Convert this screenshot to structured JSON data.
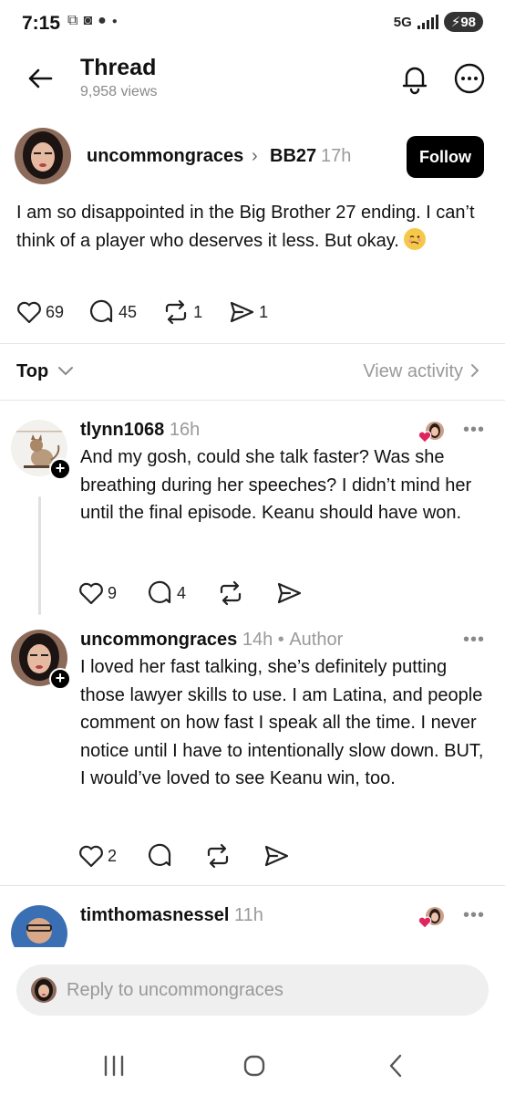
{
  "status_bar": {
    "time": "7:15",
    "network": "5G",
    "battery": "98"
  },
  "header": {
    "title": "Thread",
    "views": "9,958 views"
  },
  "post": {
    "author": "uncommongraces",
    "community": "BB27",
    "time": "17h",
    "follow_label": "Follow",
    "text": "I am so disappointed in the Big Brother 27 ending. I can’t think of a player who deserves it less. But okay.",
    "likes": "69",
    "comments": "45",
    "reposts": "1",
    "shares": "1"
  },
  "sort": {
    "label": "Top",
    "view_activity": "View activity"
  },
  "replies": [
    {
      "author": "tlynn1068",
      "time": "16h",
      "text": "And my gosh, could she talk faster?  Was she breathing during her speeches?  I didn’t mind her until the final episode.  Keanu should have won.",
      "likes": "9",
      "comments": "4"
    },
    {
      "author": "uncommongraces",
      "time": "14h",
      "tag": "Author",
      "text": "I loved her fast talking, she’s definitely putting those lawyer skills to use. I am Latina, and people comment on how fast I speak all the time. I never notice until I have to intentionally slow down. BUT, I would’ve loved to see Keanu win, too.",
      "likes": "2"
    },
    {
      "author": "timthomasnessel",
      "time": "11h"
    }
  ],
  "reply_bar": {
    "placeholder": "Reply to uncommongraces"
  },
  "icons": {
    "back": "arrow-left-icon",
    "bell": "bell-icon",
    "more": "more-horizontal-icon",
    "like": "heart-icon",
    "comment": "comment-icon",
    "repost": "repost-icon",
    "share": "share-icon"
  },
  "colors": {
    "follow_bg": "#000000",
    "muted": "#999999",
    "liked_heart": "#e0245e"
  }
}
